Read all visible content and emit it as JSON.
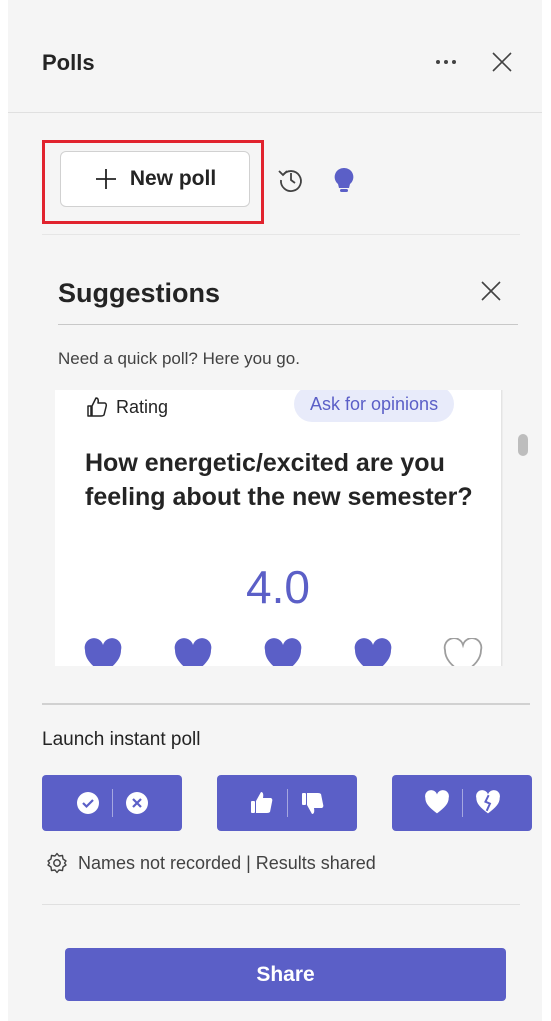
{
  "header": {
    "title": "Polls"
  },
  "toolbar": {
    "new_poll_label": "New poll"
  },
  "suggestions": {
    "title": "Suggestions",
    "subtitle": "Need a quick poll? Here you go.",
    "card": {
      "type_label": "Rating",
      "tag": "Ask for opinions",
      "question": "How energetic/excited are you feeling about the new semester?",
      "rating_value": "4.0",
      "hearts_filled": 4,
      "hearts_total": 5
    }
  },
  "instant_poll": {
    "label": "Launch instant poll",
    "buttons": [
      {
        "icons": [
          "check-circle-icon",
          "x-circle-icon"
        ]
      },
      {
        "icons": [
          "thumbs-up-icon",
          "thumbs-down-icon"
        ]
      },
      {
        "icons": [
          "heart-icon",
          "broken-heart-icon"
        ]
      }
    ],
    "settings_text": "Names not recorded | Results shared"
  },
  "share_label": "Share",
  "colors": {
    "accent": "#5b5fc7",
    "highlight": "#e1232e",
    "tag_bg": "#e8ebfa"
  }
}
